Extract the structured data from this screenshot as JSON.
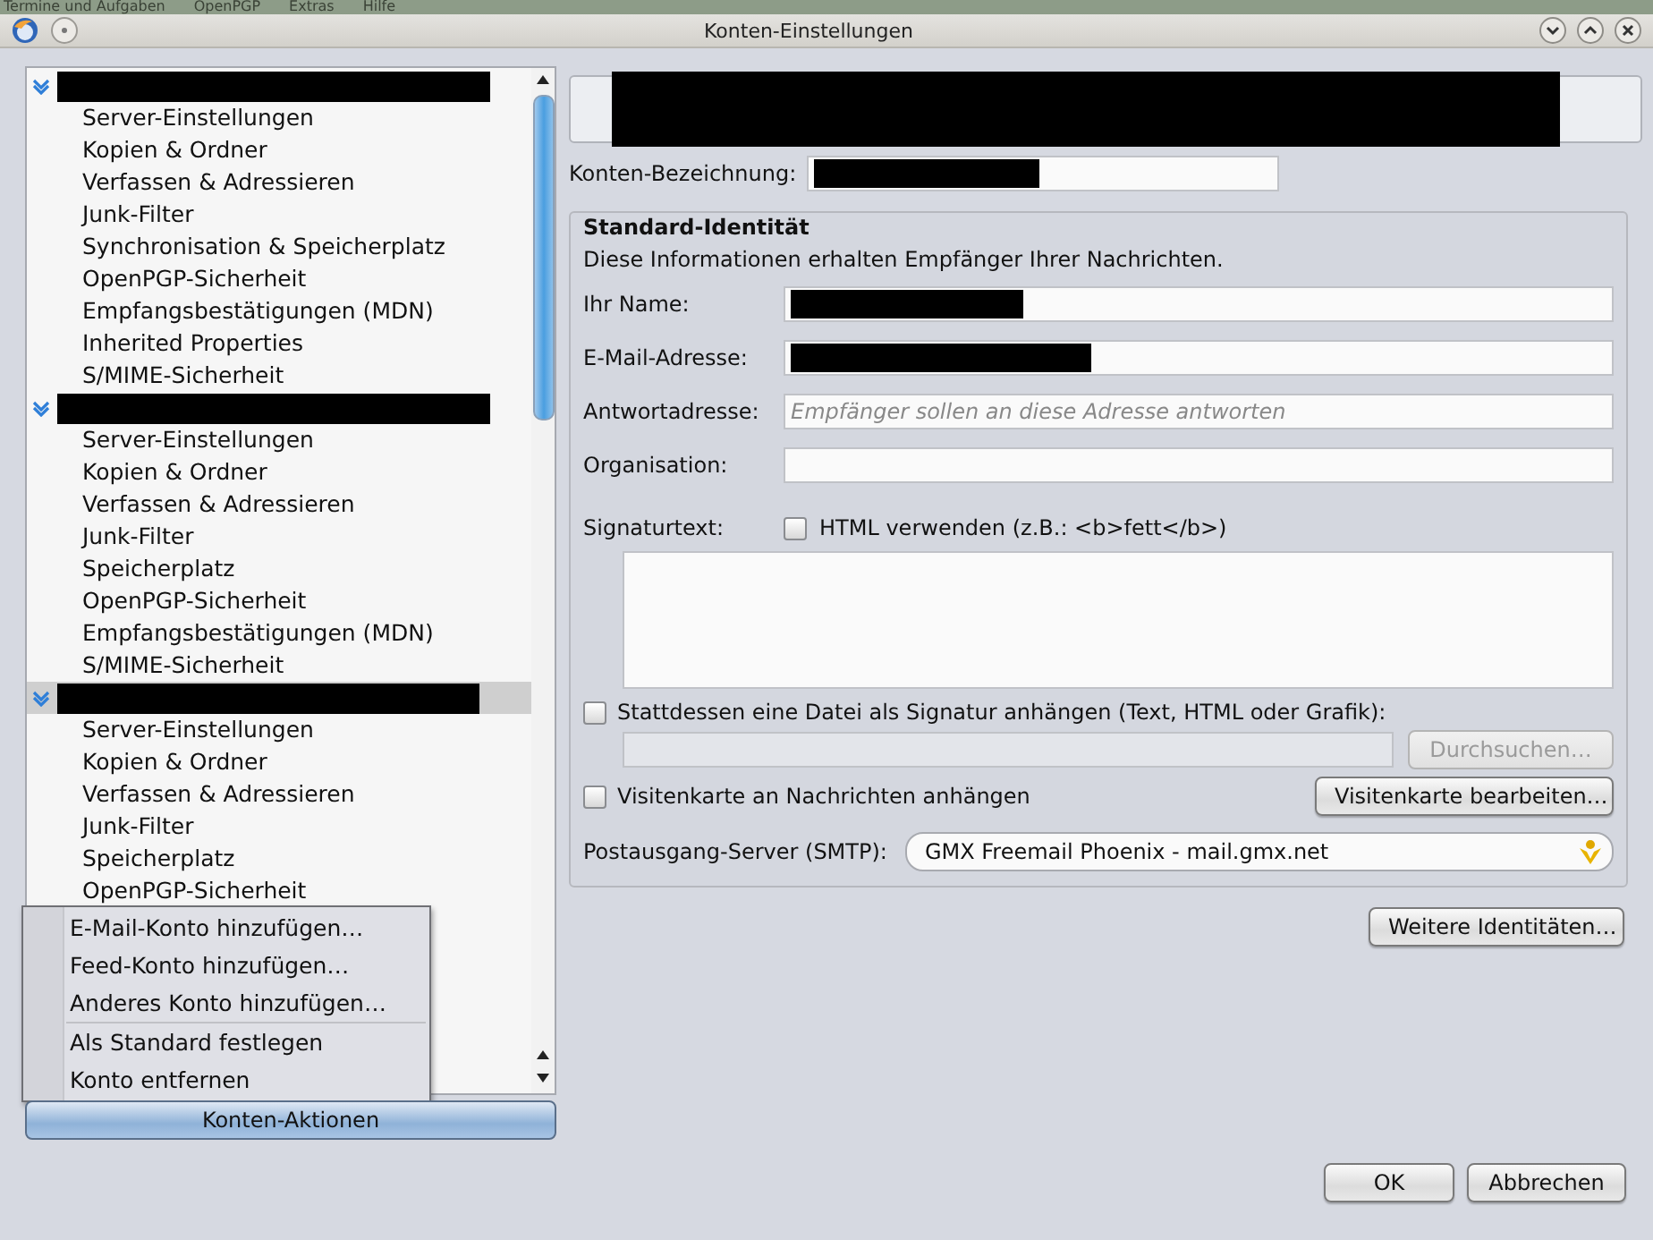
{
  "background_menu": [
    "Termine und Aufgaben",
    "OpenPGP",
    "Extras",
    "Hilfe"
  ],
  "window": {
    "title": "Konten-Einstellungen"
  },
  "accounts": [
    {
      "expanded": true,
      "selected": false,
      "children": [
        {
          "label": "Server-Einstellungen"
        },
        {
          "label": "Kopien & Ordner"
        },
        {
          "label": "Verfassen & Adressieren"
        },
        {
          "label": "Junk-Filter"
        },
        {
          "label": "Synchronisation & Speicherplatz"
        },
        {
          "label": "OpenPGP-Sicherheit"
        },
        {
          "label": "Empfangsbestätigungen (MDN)"
        },
        {
          "label": "Inherited Properties"
        },
        {
          "label": "S/MIME-Sicherheit"
        }
      ]
    },
    {
      "expanded": true,
      "selected": false,
      "children": [
        {
          "label": "Server-Einstellungen"
        },
        {
          "label": "Kopien & Ordner"
        },
        {
          "label": "Verfassen & Adressieren"
        },
        {
          "label": "Junk-Filter"
        },
        {
          "label": "Speicherplatz"
        },
        {
          "label": "OpenPGP-Sicherheit"
        },
        {
          "label": "Empfangsbestätigungen (MDN)"
        },
        {
          "label": "S/MIME-Sicherheit"
        }
      ]
    },
    {
      "expanded": true,
      "selected": true,
      "children": [
        {
          "label": "Server-Einstellungen"
        },
        {
          "label": "Kopien & Ordner"
        },
        {
          "label": "Verfassen & Adressieren"
        },
        {
          "label": "Junk-Filter"
        },
        {
          "label": "Speicherplatz"
        },
        {
          "label": "OpenPGP-Sicherheit"
        }
      ]
    }
  ],
  "account_actions": {
    "label": "Konten-Aktionen",
    "expanded": true,
    "menu": [
      {
        "kind": "item",
        "label": "E-Mail-Konto hinzufügen…"
      },
      {
        "kind": "item",
        "label": "Feed-Konto hinzufügen…"
      },
      {
        "kind": "item",
        "label": "Anderes Konto hinzufügen…"
      },
      {
        "kind": "separator"
      },
      {
        "kind": "item",
        "label": "Als Standard festlegen"
      },
      {
        "kind": "item",
        "label": "Konto entfernen"
      }
    ]
  },
  "panel": {
    "header_redacted": true,
    "account_name": {
      "label": "Konten-Bezeichnung:",
      "value_redacted": true
    },
    "identity": {
      "title": "Standard-Identität",
      "description": "Diese Informationen erhalten Empfänger Ihrer Nachrichten.",
      "fields": [
        {
          "label": "Ihr Name:",
          "value_redacted": true
        },
        {
          "label": "E-Mail-Adresse:",
          "value_redacted": true
        },
        {
          "label": "Antwortadresse:",
          "placeholder": "Empfänger sollen an diese Adresse antworten"
        },
        {
          "label": "Organisation:"
        }
      ],
      "signature": {
        "label": "Signaturtext:",
        "html_checkbox": {
          "label": "HTML verwenden (z.B.: <b>fett</b>)",
          "checked": false
        }
      },
      "signature_file": {
        "label": "Stattdessen eine Datei als Signatur anhängen (Text, HTML oder Grafik):",
        "checked": false,
        "browse_button": {
          "label": "Durchsuchen…",
          "disabled": true
        }
      },
      "vcard": {
        "label": "Visitenkarte an Nachrichten anhängen",
        "checked": false,
        "edit_button": {
          "label": "Visitenkarte bearbeiten…",
          "disabled": false
        }
      },
      "smtp": {
        "label": "Postausgang-Server (SMTP):",
        "value": "GMX Freemail Phoenix - mail.gmx.net"
      }
    },
    "more_identities_button": {
      "label": "Weitere Identitäten…"
    }
  },
  "buttons": [
    {
      "label": "OK"
    },
    {
      "label": "Abbrechen"
    }
  ]
}
